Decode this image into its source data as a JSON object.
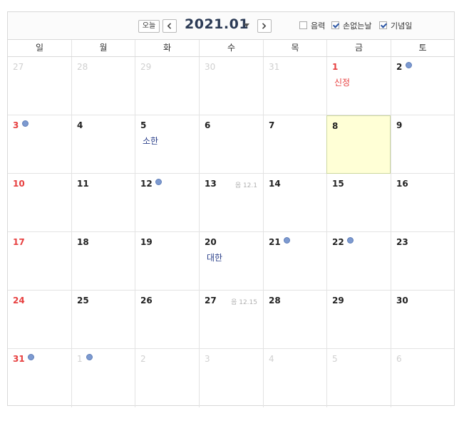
{
  "toolbar": {
    "today_label": "오늘",
    "month_title": "2021.01",
    "options": [
      {
        "label": "음력",
        "checked": false
      },
      {
        "label": "손없는날",
        "checked": true
      },
      {
        "label": "기념일",
        "checked": true
      }
    ]
  },
  "weekdays": [
    "일",
    "월",
    "화",
    "수",
    "목",
    "금",
    "토"
  ],
  "weeks": [
    [
      {
        "day": "27",
        "other": true
      },
      {
        "day": "28",
        "other": true
      },
      {
        "day": "29",
        "other": true
      },
      {
        "day": "30",
        "other": true
      },
      {
        "day": "31",
        "other": true
      },
      {
        "day": "1",
        "sunday": true,
        "holiday": "신정"
      },
      {
        "day": "2",
        "dot": true
      }
    ],
    [
      {
        "day": "3",
        "sunday": true,
        "dot": true
      },
      {
        "day": "4"
      },
      {
        "day": "5",
        "term": "소한"
      },
      {
        "day": "6"
      },
      {
        "day": "7"
      },
      {
        "day": "8",
        "today": true
      },
      {
        "day": "9"
      }
    ],
    [
      {
        "day": "10",
        "sunday": true
      },
      {
        "day": "11"
      },
      {
        "day": "12",
        "dot": true
      },
      {
        "day": "13",
        "lunar": "음 12.1"
      },
      {
        "day": "14"
      },
      {
        "day": "15"
      },
      {
        "day": "16"
      }
    ],
    [
      {
        "day": "17",
        "sunday": true
      },
      {
        "day": "18"
      },
      {
        "day": "19"
      },
      {
        "day": "20",
        "term": "대한"
      },
      {
        "day": "21",
        "dot": true
      },
      {
        "day": "22",
        "dot": true
      },
      {
        "day": "23"
      }
    ],
    [
      {
        "day": "24",
        "sunday": true
      },
      {
        "day": "25"
      },
      {
        "day": "26"
      },
      {
        "day": "27",
        "lunar": "음 12.15"
      },
      {
        "day": "28"
      },
      {
        "day": "29"
      },
      {
        "day": "30"
      }
    ],
    [
      {
        "day": "31",
        "sunday": true,
        "dot": true
      },
      {
        "day": "1",
        "other": true,
        "dot": true
      },
      {
        "day": "2",
        "other": true
      },
      {
        "day": "3",
        "other": true
      },
      {
        "day": "4",
        "other": true
      },
      {
        "day": "5",
        "other": true
      },
      {
        "day": "6",
        "other": true
      }
    ]
  ]
}
